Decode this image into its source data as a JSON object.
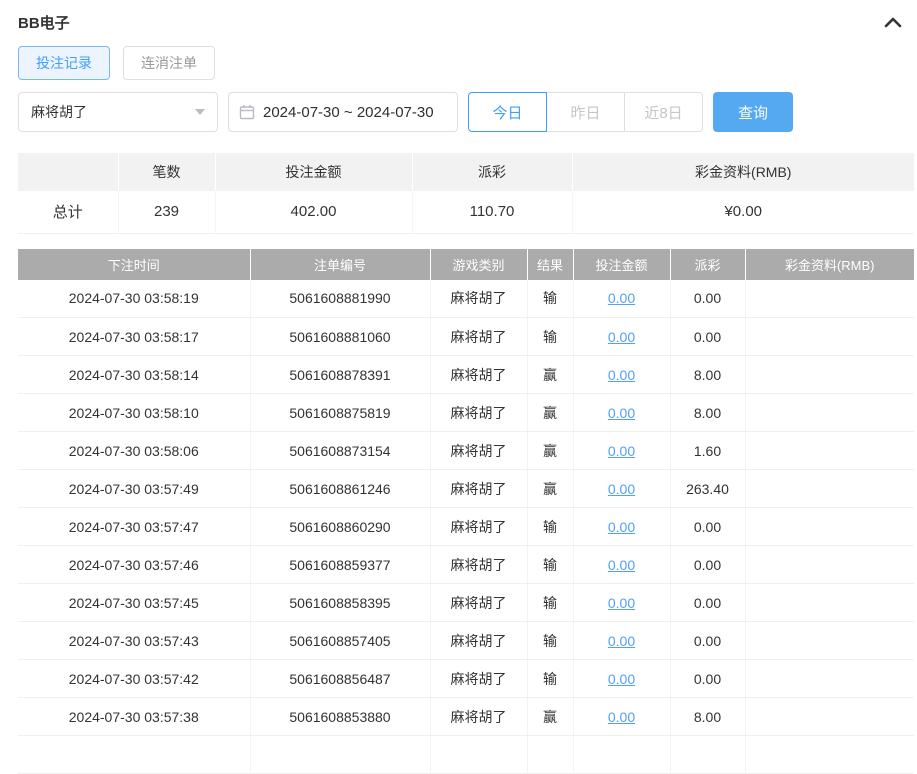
{
  "header": {
    "title": "BB电子"
  },
  "tabs": [
    {
      "label": "投注记录",
      "active": true
    },
    {
      "label": "连消注单",
      "active": false
    }
  ],
  "filters": {
    "game_select": {
      "value": "麻将胡了"
    },
    "date_range": "2024-07-30 ~ 2024-07-30",
    "quick_buttons": [
      {
        "label": "今日",
        "active": true
      },
      {
        "label": "昨日",
        "active": false
      },
      {
        "label": "近8日",
        "active": false
      }
    ],
    "search_label": "查询"
  },
  "summary": {
    "headers": [
      "",
      "笔数",
      "投注金额",
      "派彩",
      "彩金资料(RMB)"
    ],
    "row": {
      "label": "总计",
      "count": "239",
      "bet_amount": "402.00",
      "payout": "110.70",
      "jackpot": "¥0.00"
    }
  },
  "table": {
    "headers": [
      "下注时间",
      "注单编号",
      "游戏类别",
      "结果",
      "投注金额",
      "派彩",
      "彩金资料(RMB)"
    ],
    "rows": [
      [
        "2024-07-30 03:58:19",
        "5061608881990",
        "麻将胡了",
        "输",
        "0.00",
        "0.00",
        ""
      ],
      [
        "2024-07-30 03:58:17",
        "5061608881060",
        "麻将胡了",
        "输",
        "0.00",
        "0.00",
        ""
      ],
      [
        "2024-07-30 03:58:14",
        "5061608878391",
        "麻将胡了",
        "赢",
        "0.00",
        "8.00",
        ""
      ],
      [
        "2024-07-30 03:58:10",
        "5061608875819",
        "麻将胡了",
        "赢",
        "0.00",
        "8.00",
        ""
      ],
      [
        "2024-07-30 03:58:06",
        "5061608873154",
        "麻将胡了",
        "赢",
        "0.00",
        "1.60",
        ""
      ],
      [
        "2024-07-30 03:57:49",
        "5061608861246",
        "麻将胡了",
        "赢",
        "0.00",
        "263.40",
        ""
      ],
      [
        "2024-07-30 03:57:47",
        "5061608860290",
        "麻将胡了",
        "输",
        "0.00",
        "0.00",
        ""
      ],
      [
        "2024-07-30 03:57:46",
        "5061608859377",
        "麻将胡了",
        "输",
        "0.00",
        "0.00",
        ""
      ],
      [
        "2024-07-30 03:57:45",
        "5061608858395",
        "麻将胡了",
        "输",
        "0.00",
        "0.00",
        ""
      ],
      [
        "2024-07-30 03:57:43",
        "5061608857405",
        "麻将胡了",
        "输",
        "0.00",
        "0.00",
        ""
      ],
      [
        "2024-07-30 03:57:42",
        "5061608856487",
        "麻将胡了",
        "输",
        "0.00",
        "0.00",
        ""
      ],
      [
        "2024-07-30 03:57:38",
        "5061608853880",
        "麻将胡了",
        "赢",
        "0.00",
        "8.00",
        ""
      ]
    ]
  }
}
